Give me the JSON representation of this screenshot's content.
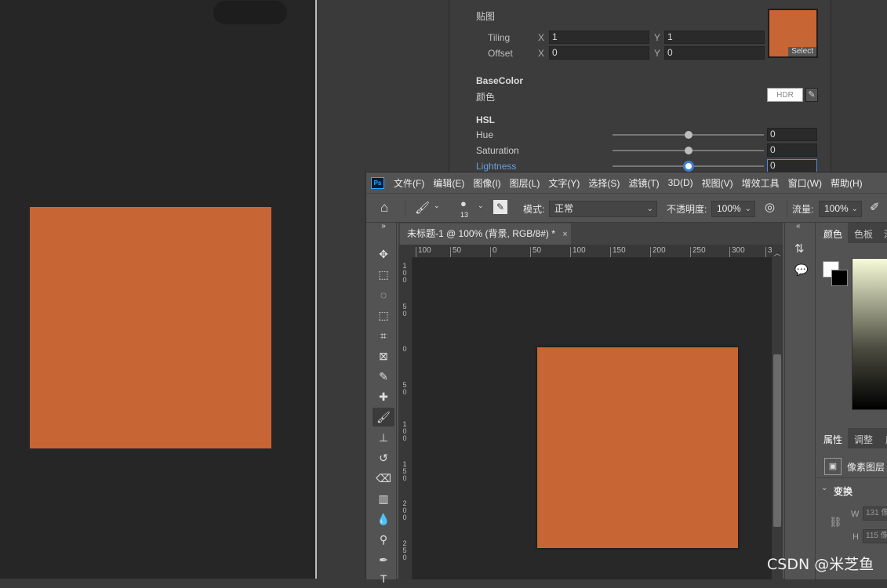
{
  "left_preview": {
    "square_color": "#c76534"
  },
  "inspector": {
    "texture_label": "贴图",
    "tiling_label": "Tiling",
    "offset_label": "Offset",
    "x_label": "X",
    "y_label": "Y",
    "tiling_x": "1",
    "tiling_y": "1",
    "offset_x": "0",
    "offset_y": "0",
    "select_label": "Select",
    "texture_color": "#c76534",
    "basecolor_header": "BaseColor",
    "color_label": "颜色",
    "hdr_label": "HDR",
    "hsl_header": "HSL",
    "hue_label": "Hue",
    "hue_value": "0",
    "saturation_label": "Saturation",
    "saturation_value": "0",
    "lightness_label": "Lightness",
    "lightness_value": "0"
  },
  "photoshop": {
    "logo": "Ps",
    "menu": [
      "文件(F)",
      "编辑(E)",
      "图像(I)",
      "图层(L)",
      "文字(Y)",
      "选择(S)",
      "滤镜(T)",
      "3D(D)",
      "视图(V)",
      "增效工具",
      "窗口(W)",
      "帮助(H)"
    ],
    "options": {
      "brush_size": "13",
      "mode_label": "模式:",
      "mode_value": "正常",
      "opacity_label": "不透明度:",
      "opacity_value": "100%",
      "flow_label": "流量:",
      "flow_value": "100%"
    },
    "doc_tab": "未标题-1 @ 100% (背景, RGB/8#) *",
    "doc_tab_close": "×",
    "ruler_top": [
      "100",
      "50",
      "0",
      "50",
      "100",
      "150",
      "200",
      "250",
      "300",
      "3"
    ],
    "ruler_left": [
      "1 0 0",
      "5 0",
      "0",
      "5 0",
      "1 0 0",
      "1 5 0",
      "2 0 0",
      "2 5 0"
    ],
    "canvas_square_color": "#c76534",
    "right_panel": {
      "tab_color": "颜色",
      "tab_swatches": "色板",
      "tab_gradient": "渐",
      "tab_properties": "属性",
      "tab_adjust": "调整",
      "tab_library": "库",
      "pixel_layer": "像素图层",
      "transform": "变换",
      "w_label": "W",
      "w_value": "131 像",
      "h_label": "H",
      "h_value": "115 像"
    }
  },
  "watermark": "CSDN @米芝鱼"
}
